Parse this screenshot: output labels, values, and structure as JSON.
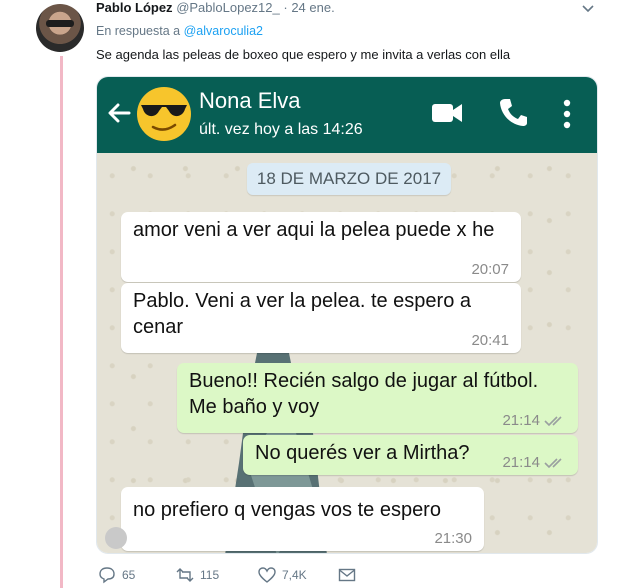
{
  "tweet": {
    "author_name": "Pablo López",
    "author_handle": "@PabloLopez12_",
    "time": "· 24 ene.",
    "reply_prefix": "En respuesta a",
    "reply_mention": "@alvaroculia2",
    "text": "Se agenda las peleas de boxeo que espero y me invita a verlas con ella",
    "actions": {
      "replies": "65",
      "retweets": "115",
      "likes": "7,4K"
    }
  },
  "whatsapp": {
    "contact_name": "Nona Elva",
    "status": "últ. vez hoy a las 14:26",
    "date_chip": "18 DE MARZO DE 2017",
    "messages": [
      {
        "direction": "in",
        "text": "amor veni a ver aqui la pelea puede x he",
        "time": "20:07"
      },
      {
        "direction": "in",
        "text": "Pablo. Veni a ver la pelea. te espero a cenar",
        "time": "20:41"
      },
      {
        "direction": "out",
        "text": "Bueno!! Recién salgo de jugar al fútbol. Me baño y voy",
        "time": "21:14"
      },
      {
        "direction": "out",
        "text": "No querés ver a Mirtha?",
        "time": "21:14"
      },
      {
        "direction": "in",
        "text": "no prefiero q vengas vos te espero",
        "time": "21:30"
      }
    ]
  },
  "colors": {
    "wa_header": "#075e54",
    "bubble_out": "#dcf8c6",
    "mention": "#1da1f2",
    "thread_line": "#f2b8c6"
  },
  "icons": [
    "caret-down-icon",
    "back-arrow-icon",
    "sunglasses-emoji-icon",
    "video-call-icon",
    "phone-icon",
    "more-vert-icon",
    "double-check-icon",
    "reply-icon",
    "retweet-icon",
    "like-icon",
    "dm-icon"
  ]
}
